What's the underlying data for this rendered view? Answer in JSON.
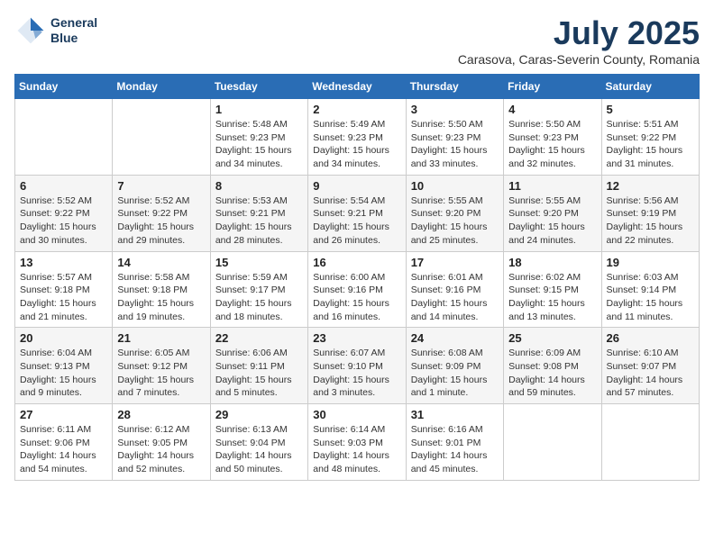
{
  "header": {
    "logo_line1": "General",
    "logo_line2": "Blue",
    "month": "July 2025",
    "location": "Carasova, Caras-Severin County, Romania"
  },
  "weekdays": [
    "Sunday",
    "Monday",
    "Tuesday",
    "Wednesday",
    "Thursday",
    "Friday",
    "Saturday"
  ],
  "weeks": [
    [
      {
        "day": "",
        "detail": ""
      },
      {
        "day": "",
        "detail": ""
      },
      {
        "day": "1",
        "detail": "Sunrise: 5:48 AM\nSunset: 9:23 PM\nDaylight: 15 hours\nand 34 minutes."
      },
      {
        "day": "2",
        "detail": "Sunrise: 5:49 AM\nSunset: 9:23 PM\nDaylight: 15 hours\nand 34 minutes."
      },
      {
        "day": "3",
        "detail": "Sunrise: 5:50 AM\nSunset: 9:23 PM\nDaylight: 15 hours\nand 33 minutes."
      },
      {
        "day": "4",
        "detail": "Sunrise: 5:50 AM\nSunset: 9:23 PM\nDaylight: 15 hours\nand 32 minutes."
      },
      {
        "day": "5",
        "detail": "Sunrise: 5:51 AM\nSunset: 9:22 PM\nDaylight: 15 hours\nand 31 minutes."
      }
    ],
    [
      {
        "day": "6",
        "detail": "Sunrise: 5:52 AM\nSunset: 9:22 PM\nDaylight: 15 hours\nand 30 minutes."
      },
      {
        "day": "7",
        "detail": "Sunrise: 5:52 AM\nSunset: 9:22 PM\nDaylight: 15 hours\nand 29 minutes."
      },
      {
        "day": "8",
        "detail": "Sunrise: 5:53 AM\nSunset: 9:21 PM\nDaylight: 15 hours\nand 28 minutes."
      },
      {
        "day": "9",
        "detail": "Sunrise: 5:54 AM\nSunset: 9:21 PM\nDaylight: 15 hours\nand 26 minutes."
      },
      {
        "day": "10",
        "detail": "Sunrise: 5:55 AM\nSunset: 9:20 PM\nDaylight: 15 hours\nand 25 minutes."
      },
      {
        "day": "11",
        "detail": "Sunrise: 5:55 AM\nSunset: 9:20 PM\nDaylight: 15 hours\nand 24 minutes."
      },
      {
        "day": "12",
        "detail": "Sunrise: 5:56 AM\nSunset: 9:19 PM\nDaylight: 15 hours\nand 22 minutes."
      }
    ],
    [
      {
        "day": "13",
        "detail": "Sunrise: 5:57 AM\nSunset: 9:18 PM\nDaylight: 15 hours\nand 21 minutes."
      },
      {
        "day": "14",
        "detail": "Sunrise: 5:58 AM\nSunset: 9:18 PM\nDaylight: 15 hours\nand 19 minutes."
      },
      {
        "day": "15",
        "detail": "Sunrise: 5:59 AM\nSunset: 9:17 PM\nDaylight: 15 hours\nand 18 minutes."
      },
      {
        "day": "16",
        "detail": "Sunrise: 6:00 AM\nSunset: 9:16 PM\nDaylight: 15 hours\nand 16 minutes."
      },
      {
        "day": "17",
        "detail": "Sunrise: 6:01 AM\nSunset: 9:16 PM\nDaylight: 15 hours\nand 14 minutes."
      },
      {
        "day": "18",
        "detail": "Sunrise: 6:02 AM\nSunset: 9:15 PM\nDaylight: 15 hours\nand 13 minutes."
      },
      {
        "day": "19",
        "detail": "Sunrise: 6:03 AM\nSunset: 9:14 PM\nDaylight: 15 hours\nand 11 minutes."
      }
    ],
    [
      {
        "day": "20",
        "detail": "Sunrise: 6:04 AM\nSunset: 9:13 PM\nDaylight: 15 hours\nand 9 minutes."
      },
      {
        "day": "21",
        "detail": "Sunrise: 6:05 AM\nSunset: 9:12 PM\nDaylight: 15 hours\nand 7 minutes."
      },
      {
        "day": "22",
        "detail": "Sunrise: 6:06 AM\nSunset: 9:11 PM\nDaylight: 15 hours\nand 5 minutes."
      },
      {
        "day": "23",
        "detail": "Sunrise: 6:07 AM\nSunset: 9:10 PM\nDaylight: 15 hours\nand 3 minutes."
      },
      {
        "day": "24",
        "detail": "Sunrise: 6:08 AM\nSunset: 9:09 PM\nDaylight: 15 hours\nand 1 minute."
      },
      {
        "day": "25",
        "detail": "Sunrise: 6:09 AM\nSunset: 9:08 PM\nDaylight: 14 hours\nand 59 minutes."
      },
      {
        "day": "26",
        "detail": "Sunrise: 6:10 AM\nSunset: 9:07 PM\nDaylight: 14 hours\nand 57 minutes."
      }
    ],
    [
      {
        "day": "27",
        "detail": "Sunrise: 6:11 AM\nSunset: 9:06 PM\nDaylight: 14 hours\nand 54 minutes."
      },
      {
        "day": "28",
        "detail": "Sunrise: 6:12 AM\nSunset: 9:05 PM\nDaylight: 14 hours\nand 52 minutes."
      },
      {
        "day": "29",
        "detail": "Sunrise: 6:13 AM\nSunset: 9:04 PM\nDaylight: 14 hours\nand 50 minutes."
      },
      {
        "day": "30",
        "detail": "Sunrise: 6:14 AM\nSunset: 9:03 PM\nDaylight: 14 hours\nand 48 minutes."
      },
      {
        "day": "31",
        "detail": "Sunrise: 6:16 AM\nSunset: 9:01 PM\nDaylight: 14 hours\nand 45 minutes."
      },
      {
        "day": "",
        "detail": ""
      },
      {
        "day": "",
        "detail": ""
      }
    ]
  ]
}
